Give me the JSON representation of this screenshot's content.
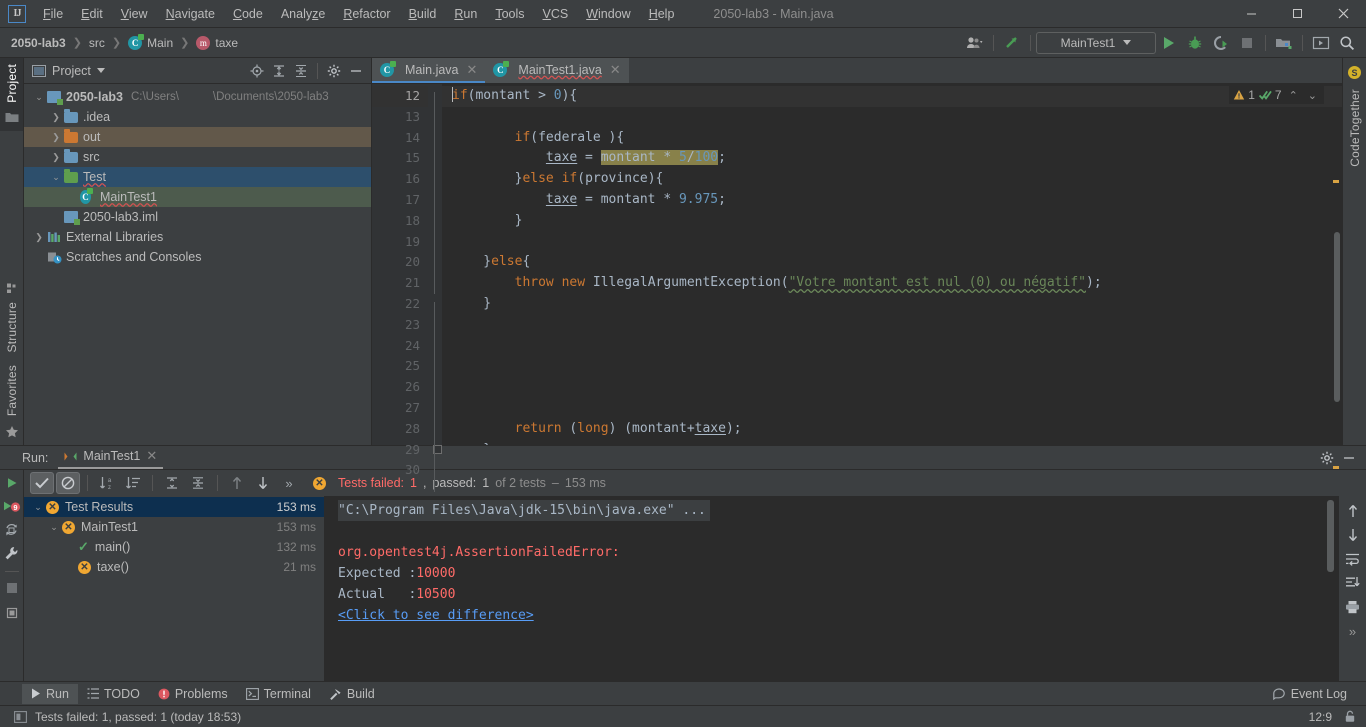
{
  "window": {
    "title": "2050-lab3 - Main.java",
    "app_icon": "intellij-idea-logo",
    "minimize": "—",
    "maximize": "▢",
    "close": "✕"
  },
  "menubar": {
    "items": [
      {
        "label": "File",
        "mnemonic": "F"
      },
      {
        "label": "Edit",
        "mnemonic": "E"
      },
      {
        "label": "View",
        "mnemonic": "V"
      },
      {
        "label": "Navigate",
        "mnemonic": "N"
      },
      {
        "label": "Code",
        "mnemonic": "C"
      },
      {
        "label": "Analyze",
        "mnemonic": "z"
      },
      {
        "label": "Refactor",
        "mnemonic": "R"
      },
      {
        "label": "Build",
        "mnemonic": "B"
      },
      {
        "label": "Run",
        "mnemonic": "R"
      },
      {
        "label": "Tools",
        "mnemonic": "T"
      },
      {
        "label": "VCS",
        "mnemonic": "V"
      },
      {
        "label": "Window",
        "mnemonic": "W"
      },
      {
        "label": "Help",
        "mnemonic": "H"
      }
    ]
  },
  "breadcrumb": {
    "items": [
      "2050-lab3",
      "src",
      "Main",
      "taxe"
    ]
  },
  "toolbar": {
    "run_config": "MainTest1",
    "buttons": [
      "user-icon",
      "vcs-update-icon",
      "run-icon",
      "debug-icon",
      "run-coverage-icon",
      "stop-icon",
      "project-structure-icon",
      "select-target-icon",
      "search-everywhere-icon"
    ]
  },
  "project_pane": {
    "title": "Project",
    "header_buttons": [
      "locate-icon",
      "expand-all-icon",
      "collapse-all-icon",
      "settings-icon",
      "hide-icon"
    ],
    "tree": [
      {
        "label": "2050-lab3",
        "detail_left": "C:\\Users\\",
        "detail_right": "\\Documents\\2050-lab3",
        "icon": "module-icon",
        "indent": 0,
        "arrow": "expanded",
        "bold": true,
        "state": "none"
      },
      {
        "label": ".idea",
        "icon": "folder-blue-icon",
        "indent": 1,
        "arrow": "collapsed",
        "state": "none"
      },
      {
        "label": "out",
        "icon": "folder-orange-icon",
        "indent": 1,
        "arrow": "collapsed",
        "state": "brown"
      },
      {
        "label": "src",
        "icon": "folder-blue-icon",
        "indent": 1,
        "arrow": "collapsed",
        "state": "none"
      },
      {
        "label": "Test",
        "icon": "folder-green-icon",
        "indent": 1,
        "arrow": "expanded",
        "state": "blue"
      },
      {
        "label": "MainTest1",
        "icon": "java-class-icon",
        "indent": 2,
        "arrow": "none",
        "state": "green"
      },
      {
        "label": "2050-lab3.iml",
        "icon": "iml-file-icon",
        "indent": 1,
        "arrow": "none",
        "state": "none"
      },
      {
        "label": "External Libraries",
        "icon": "libraries-icon",
        "indent": 0,
        "arrow": "collapsed",
        "state": "none"
      },
      {
        "label": "Scratches and Consoles",
        "icon": "scratches-icon",
        "indent": 0,
        "arrow": "none",
        "state": "none"
      }
    ]
  },
  "left_strip": {
    "top": "Project",
    "bottom": [
      "Structure",
      "Favorites"
    ]
  },
  "right_strip": {
    "label": "CodeTogether"
  },
  "editor": {
    "tabs": [
      {
        "label": "Main.java",
        "icon": "java-class-icon",
        "active": true
      },
      {
        "label": "MainTest1.java",
        "icon": "java-class-icon",
        "active": false,
        "error": true
      }
    ],
    "inspection": {
      "warning_count": "1",
      "check_count": "7"
    },
    "first_line_number": 12,
    "lines": [
      {
        "n": 12,
        "current": true,
        "fold": "minus",
        "tokens": [
          {
            "t": "caret"
          },
          {
            "t": "kw",
            "v": "if"
          },
          {
            "t": "plain",
            "v": "("
          },
          {
            "t": "plain",
            "v": "montant"
          },
          {
            "t": "plain",
            "v": " > "
          },
          {
            "t": "num",
            "v": "0"
          },
          {
            "t": "plain",
            "v": "){"
          }
        ]
      },
      {
        "n": 13,
        "current": false,
        "fold": "",
        "tokens": []
      },
      {
        "n": 14,
        "current": false,
        "fold": "minus",
        "tokens": [
          {
            "t": "plain",
            "v": "        "
          },
          {
            "t": "kw",
            "v": "if"
          },
          {
            "t": "plain",
            "v": "(federale ){"
          }
        ]
      },
      {
        "n": 15,
        "current": false,
        "fold": "",
        "tokens": [
          {
            "t": "plain",
            "v": "            "
          },
          {
            "t": "uident",
            "v": "taxe"
          },
          {
            "t": "plain",
            "v": " = "
          },
          {
            "t": "hl",
            "v": "montant * "
          },
          {
            "t": "hlnum",
            "v": "5"
          },
          {
            "t": "hl",
            "v": "/"
          },
          {
            "t": "hlnum",
            "v": "100"
          },
          {
            "t": "plain",
            "v": ";"
          }
        ]
      },
      {
        "n": 16,
        "current": false,
        "fold": "plus",
        "tokens": [
          {
            "t": "plain",
            "v": "        }"
          },
          {
            "t": "kw",
            "v": "else "
          },
          {
            "t": "kw",
            "v": "if"
          },
          {
            "t": "plain",
            "v": "(province){"
          }
        ]
      },
      {
        "n": 17,
        "current": false,
        "fold": "",
        "tokens": [
          {
            "t": "plain",
            "v": "            "
          },
          {
            "t": "uident",
            "v": "taxe"
          },
          {
            "t": "plain",
            "v": " = montant * "
          },
          {
            "t": "num",
            "v": "9.975"
          },
          {
            "t": "plain",
            "v": ";"
          }
        ]
      },
      {
        "n": 18,
        "current": false,
        "fold": "plus",
        "tokens": [
          {
            "t": "plain",
            "v": "        }"
          }
        ]
      },
      {
        "n": 19,
        "current": false,
        "fold": "",
        "tokens": []
      },
      {
        "n": 20,
        "current": false,
        "fold": "minus",
        "tokens": [
          {
            "t": "plain",
            "v": "    }"
          },
          {
            "t": "kw",
            "v": "else"
          },
          {
            "t": "plain",
            "v": "{"
          }
        ]
      },
      {
        "n": 21,
        "current": false,
        "fold": "",
        "tokens": [
          {
            "t": "plain",
            "v": "        "
          },
          {
            "t": "kw",
            "v": "throw new "
          },
          {
            "t": "plain",
            "v": "IllegalArgumentException("
          },
          {
            "t": "str",
            "v": "\"Votre montant est nul (0) ou négatif\""
          },
          {
            "t": "plain",
            "v": ");"
          }
        ]
      },
      {
        "n": 22,
        "current": false,
        "fold": "plus",
        "tokens": [
          {
            "t": "plain",
            "v": "    }"
          }
        ]
      },
      {
        "n": 23,
        "current": false,
        "fold": "",
        "tokens": []
      },
      {
        "n": 24,
        "current": false,
        "fold": "",
        "tokens": []
      },
      {
        "n": 25,
        "current": false,
        "fold": "",
        "tokens": []
      },
      {
        "n": 26,
        "current": false,
        "fold": "",
        "tokens": []
      },
      {
        "n": 27,
        "current": false,
        "fold": "",
        "tokens": []
      },
      {
        "n": 28,
        "current": false,
        "fold": "",
        "tokens": [
          {
            "t": "plain",
            "v": "        "
          },
          {
            "t": "kw",
            "v": "return"
          },
          {
            "t": "plain",
            "v": " ("
          },
          {
            "t": "kw",
            "v": "long"
          },
          {
            "t": "plain",
            "v": ") (montant+"
          },
          {
            "t": "uident",
            "v": "taxe"
          },
          {
            "t": "plain",
            "v": ");"
          }
        ]
      },
      {
        "n": 29,
        "current": false,
        "fold": "plus",
        "tokens": [
          {
            "t": "plain",
            "v": "    }"
          }
        ]
      },
      {
        "n": 30,
        "current": false,
        "fold": "",
        "tokens": [
          {
            "t": "plain",
            "v": "}"
          }
        ]
      }
    ]
  },
  "run_panel": {
    "label": "Run:",
    "tab": "MainTest1",
    "toolbar_buttons": [
      "rerun-icon",
      "show-passed-icon",
      "hide-ignored-icon",
      "sort-alphabetically-icon",
      "sort-by-duration-icon",
      "expand-all-icon",
      "collapse-all-icon",
      "prev-failed-icon",
      "next-failed-icon",
      "more-icon"
    ],
    "gutter_buttons": [
      "rerun-icon",
      "rerun-failed-icon",
      "toggle-auto-test-icon",
      "settings-wrench-icon",
      "stop-icon",
      "pin-icon"
    ],
    "right_buttons": [
      "scroll-up-icon",
      "scroll-down-icon",
      "soft-wrap-icon",
      "scroll-to-end-icon",
      "print-icon",
      "more-icon"
    ],
    "status": {
      "failed_label": "Tests failed:",
      "failed_count": "1",
      "passed_label": "passed:",
      "passed_count": "1",
      "of_text": "of 2 tests",
      "duration": "153 ms"
    },
    "tests": [
      {
        "label": "Test Results",
        "time": "153 ms",
        "status": "failed",
        "indent": 0,
        "arrow": "expanded",
        "selected": true
      },
      {
        "label": "MainTest1",
        "time": "153 ms",
        "status": "failed",
        "indent": 1,
        "arrow": "expanded",
        "selected": false
      },
      {
        "label": "main()",
        "time": "132 ms",
        "status": "passed",
        "indent": 2,
        "arrow": "none",
        "selected": false
      },
      {
        "label": "taxe()",
        "time": "21 ms",
        "status": "failed",
        "indent": 2,
        "arrow": "none",
        "selected": false
      }
    ],
    "console": [
      {
        "text": "\"C:\\Program Files\\Java\\jdk-15\\bin\\java.exe\" ...",
        "style": "cmd"
      },
      {
        "text": "",
        "style": "plain"
      },
      {
        "text": "org.opentest4j.AssertionFailedError:",
        "style": "error"
      },
      {
        "text": "Expected :10000",
        "style": "expected"
      },
      {
        "text": "Actual   :10500",
        "style": "expected"
      },
      {
        "text": "<Click to see difference>",
        "style": "link"
      }
    ]
  },
  "bottom_bar": {
    "items": [
      {
        "label": "Run",
        "icon": "run-icon",
        "active": true
      },
      {
        "label": "TODO",
        "icon": "todo-icon",
        "active": false
      },
      {
        "label": "Problems",
        "icon": "problems-icon",
        "active": false
      },
      {
        "label": "Terminal",
        "icon": "terminal-icon",
        "active": false
      },
      {
        "label": "Build",
        "icon": "build-hammer-icon",
        "active": false
      }
    ],
    "event_log": "Event Log"
  },
  "status_bar": {
    "message": "Tests failed: 1, passed: 1 (today 18:53)",
    "caret_position": "12:9",
    "lock_icon": "lock-icon"
  },
  "colors": {
    "accent_blue": "#4a88c7",
    "green": "#59a869",
    "error_red": "#ff6b68",
    "warning_orange": "#f0a732",
    "selection_blue": "#2d4f6c"
  }
}
